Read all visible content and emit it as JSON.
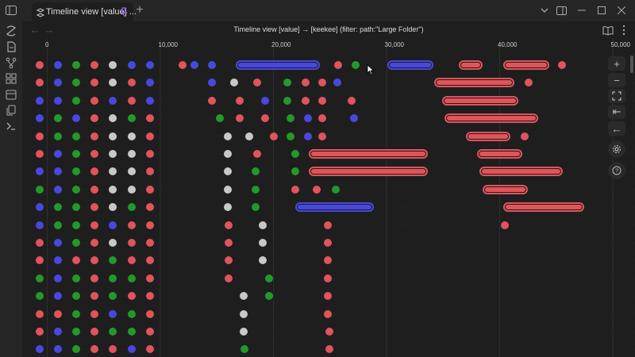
{
  "tab": {
    "title": "Timeline view [value] ...",
    "new_tab_label": "+"
  },
  "view": {
    "title": "Timeline view [value] → [keekee] (filter: path:\"Large Folder\")",
    "back_label": "←",
    "forward_label": "→"
  },
  "ruler": {
    "labels": [
      "0",
      "10,000",
      "20,000",
      "30,000",
      "40,000",
      "50,000"
    ],
    "values": [
      0,
      10000,
      20000,
      30000,
      40000,
      50000
    ]
  },
  "controls": {
    "zoom_in_label": "+",
    "zoom_out_label": "−",
    "fit_label": "⛶",
    "to_start_label": "⇤",
    "back_label": "←"
  },
  "colors": {
    "red": "#e0545a",
    "blue": "#4848e0",
    "green": "#22992a",
    "gray": "#c8c8c8",
    "background": "#1e1e1e",
    "chrome": "#262626"
  },
  "icons": {
    "sidebar": "sidebar-toggle-icon",
    "tab": "canvas-icon",
    "pin": "pin-icon",
    "ribbon": [
      "graph-icon",
      "file-icon",
      "git-branch-icon",
      "grid-icon",
      "calendar-icon",
      "copy-icon",
      "terminal-icon"
    ],
    "header": [
      "book-icon",
      "more-icon"
    ],
    "controls": [
      "settings-icon",
      "help-icon"
    ]
  },
  "timeline": {
    "rows": [
      {
        "dots": [
          [
            -1,
            "r"
          ],
          [
            0,
            "b"
          ],
          [
            1,
            "g"
          ],
          [
            2,
            "r"
          ],
          [
            3,
            "w"
          ],
          [
            4,
            "b"
          ],
          [
            5,
            "b"
          ],
          [
            11900,
            "r"
          ],
          [
            13000,
            "b"
          ],
          [
            14500,
            "b"
          ],
          [
            25700,
            "r"
          ],
          [
            27200,
            "g"
          ],
          [
            45500,
            "r"
          ]
        ],
        "ranges": [
          [
            16800,
            23900,
            "b"
          ],
          [
            30200,
            34000,
            "b"
          ],
          [
            36500,
            38300,
            "r"
          ],
          [
            40400,
            44200,
            "r"
          ]
        ]
      },
      {
        "dots": [
          [
            -1,
            "r"
          ],
          [
            0,
            "b"
          ],
          [
            1,
            "g"
          ],
          [
            2,
            "r"
          ],
          [
            3,
            "w"
          ],
          [
            4,
            "r"
          ],
          [
            5,
            "b"
          ],
          [
            14500,
            "b"
          ],
          [
            16500,
            "w"
          ],
          [
            18500,
            "r"
          ],
          [
            21200,
            "g"
          ],
          [
            22800,
            "r"
          ],
          [
            24300,
            "r"
          ],
          [
            25600,
            "b"
          ],
          [
            42500,
            "r"
          ]
        ],
        "ranges": [
          [
            34300,
            41100,
            "r"
          ]
        ]
      },
      {
        "dots": [
          [
            -1,
            "b"
          ],
          [
            0,
            "b"
          ],
          [
            1,
            "g"
          ],
          [
            2,
            "r"
          ],
          [
            3,
            "b"
          ],
          [
            4,
            "r"
          ],
          [
            5,
            "b"
          ],
          [
            14500,
            "r"
          ],
          [
            17000,
            "r"
          ],
          [
            19200,
            "b"
          ],
          [
            21200,
            "g"
          ],
          [
            22800,
            "r"
          ],
          [
            24300,
            "r"
          ],
          [
            26900,
            "r"
          ]
        ],
        "ranges": [
          [
            35000,
            41500,
            "r"
          ]
        ]
      },
      {
        "dots": [
          [
            -1,
            "b"
          ],
          [
            0,
            "g"
          ],
          [
            1,
            "b"
          ],
          [
            2,
            "r"
          ],
          [
            3,
            "w"
          ],
          [
            4,
            "g"
          ],
          [
            5,
            "r"
          ],
          [
            15200,
            "g"
          ],
          [
            17000,
            "r"
          ],
          [
            19200,
            "r"
          ],
          [
            21500,
            "g"
          ],
          [
            23000,
            "b"
          ],
          [
            24300,
            "r"
          ],
          [
            27100,
            "b"
          ]
        ],
        "ranges": [
          [
            35200,
            43200,
            "r"
          ]
        ]
      },
      {
        "dots": [
          [
            -1,
            "r"
          ],
          [
            0,
            "g"
          ],
          [
            1,
            "g"
          ],
          [
            2,
            "r"
          ],
          [
            3,
            "w"
          ],
          [
            4,
            "w"
          ],
          [
            5,
            "r"
          ],
          [
            15900,
            "w"
          ],
          [
            17800,
            "w"
          ],
          [
            20000,
            "r"
          ],
          [
            21500,
            "g"
          ],
          [
            23000,
            "b"
          ],
          [
            24300,
            "r"
          ],
          [
            42200,
            "r"
          ]
        ],
        "ranges": [
          [
            37100,
            40800,
            "r"
          ]
        ]
      },
      {
        "dots": [
          [
            -1,
            "r"
          ],
          [
            0,
            "b"
          ],
          [
            1,
            "g"
          ],
          [
            2,
            "r"
          ],
          [
            3,
            "w"
          ],
          [
            4,
            "w"
          ],
          [
            5,
            "r"
          ],
          [
            15900,
            "w"
          ],
          [
            18500,
            "r"
          ],
          [
            21900,
            "g"
          ]
        ],
        "ranges": [
          [
            23200,
            33500,
            "r"
          ],
          [
            38100,
            41800,
            "r"
          ]
        ]
      },
      {
        "dots": [
          [
            -1,
            "b"
          ],
          [
            0,
            "b"
          ],
          [
            1,
            "g"
          ],
          [
            2,
            "r"
          ],
          [
            3,
            "w"
          ],
          [
            4,
            "w"
          ],
          [
            5,
            "r"
          ],
          [
            15900,
            "w"
          ],
          [
            18400,
            "g"
          ],
          [
            21900,
            "g"
          ]
        ],
        "ranges": [
          [
            23200,
            33500,
            "r"
          ],
          [
            38300,
            45400,
            "r"
          ]
        ]
      },
      {
        "dots": [
          [
            -1,
            "g"
          ],
          [
            0,
            "b"
          ],
          [
            1,
            "g"
          ],
          [
            2,
            "r"
          ],
          [
            3,
            "w"
          ],
          [
            4,
            "w"
          ],
          [
            5,
            "r"
          ],
          [
            15900,
            "w"
          ],
          [
            18400,
            "g"
          ],
          [
            21900,
            "r"
          ],
          [
            23800,
            "r"
          ],
          [
            25500,
            "g"
          ]
        ],
        "ranges": [
          [
            38600,
            42300,
            "r"
          ]
        ]
      },
      {
        "dots": [
          [
            -1,
            "b"
          ],
          [
            0,
            "g"
          ],
          [
            1,
            "g"
          ],
          [
            2,
            "r"
          ],
          [
            3,
            "w"
          ],
          [
            4,
            "g"
          ],
          [
            5,
            "r"
          ],
          [
            15900,
            "w"
          ],
          [
            18400,
            "g"
          ]
        ],
        "ranges": [
          [
            22000,
            28700,
            "b"
          ],
          [
            40400,
            47300,
            "r"
          ]
        ]
      },
      {
        "dots": [
          [
            -1,
            "b"
          ],
          [
            0,
            "g"
          ],
          [
            1,
            "g"
          ],
          [
            2,
            "r"
          ],
          [
            3,
            "b"
          ],
          [
            4,
            "r"
          ],
          [
            5,
            "r"
          ],
          [
            16000,
            "r"
          ],
          [
            19000,
            "w"
          ],
          [
            24800,
            "r"
          ],
          [
            40400,
            "r"
          ]
        ],
        "ranges": []
      },
      {
        "dots": [
          [
            -1,
            "r"
          ],
          [
            0,
            "b"
          ],
          [
            1,
            "g"
          ],
          [
            2,
            "r"
          ],
          [
            3,
            "w"
          ],
          [
            4,
            "r"
          ],
          [
            5,
            "r"
          ],
          [
            16000,
            "r"
          ],
          [
            19000,
            "w"
          ],
          [
            24800,
            "r"
          ]
        ],
        "ranges": []
      },
      {
        "dots": [
          [
            -1,
            "r"
          ],
          [
            0,
            "b"
          ],
          [
            1,
            "r"
          ],
          [
            2,
            "r"
          ],
          [
            3,
            "g"
          ],
          [
            4,
            "r"
          ],
          [
            5,
            "r"
          ],
          [
            16000,
            "r"
          ],
          [
            19000,
            "w"
          ],
          [
            24800,
            "r"
          ]
        ],
        "ranges": []
      },
      {
        "dots": [
          [
            -1,
            "g"
          ],
          [
            0,
            "b"
          ],
          [
            1,
            "g"
          ],
          [
            2,
            "r"
          ],
          [
            3,
            "g"
          ],
          [
            4,
            "g"
          ],
          [
            5,
            "r"
          ],
          [
            16000,
            "r"
          ],
          [
            19600,
            "g"
          ],
          [
            24800,
            "r"
          ]
        ],
        "ranges": []
      },
      {
        "dots": [
          [
            -1,
            "g"
          ],
          [
            0,
            "b"
          ],
          [
            1,
            "g"
          ],
          [
            2,
            "r"
          ],
          [
            3,
            "g"
          ],
          [
            4,
            "r"
          ],
          [
            5,
            "r"
          ],
          [
            17300,
            "w"
          ],
          [
            19600,
            "g"
          ],
          [
            24800,
            "r"
          ]
        ],
        "ranges": []
      },
      {
        "dots": [
          [
            -1,
            "r"
          ],
          [
            0,
            "r"
          ],
          [
            1,
            "g"
          ],
          [
            2,
            "r"
          ],
          [
            3,
            "b"
          ],
          [
            4,
            "g"
          ],
          [
            5,
            "r"
          ],
          [
            17300,
            "w"
          ],
          [
            24800,
            "r"
          ]
        ],
        "ranges": []
      },
      {
        "dots": [
          [
            -1,
            "r"
          ],
          [
            0,
            "b"
          ],
          [
            1,
            "g"
          ],
          [
            2,
            "r"
          ],
          [
            3,
            "g"
          ],
          [
            4,
            "g"
          ],
          [
            5,
            "r"
          ],
          [
            17300,
            "w"
          ],
          [
            24900,
            "r"
          ]
        ],
        "ranges": []
      },
      {
        "dots": [
          [
            -1,
            "b"
          ],
          [
            0,
            "b"
          ],
          [
            1,
            "g"
          ],
          [
            2,
            "r"
          ],
          [
            3,
            "r"
          ],
          [
            4,
            "b"
          ],
          [
            5,
            "r"
          ],
          [
            17400,
            "g"
          ],
          [
            24900,
            "r"
          ]
        ],
        "ranges": []
      }
    ]
  }
}
